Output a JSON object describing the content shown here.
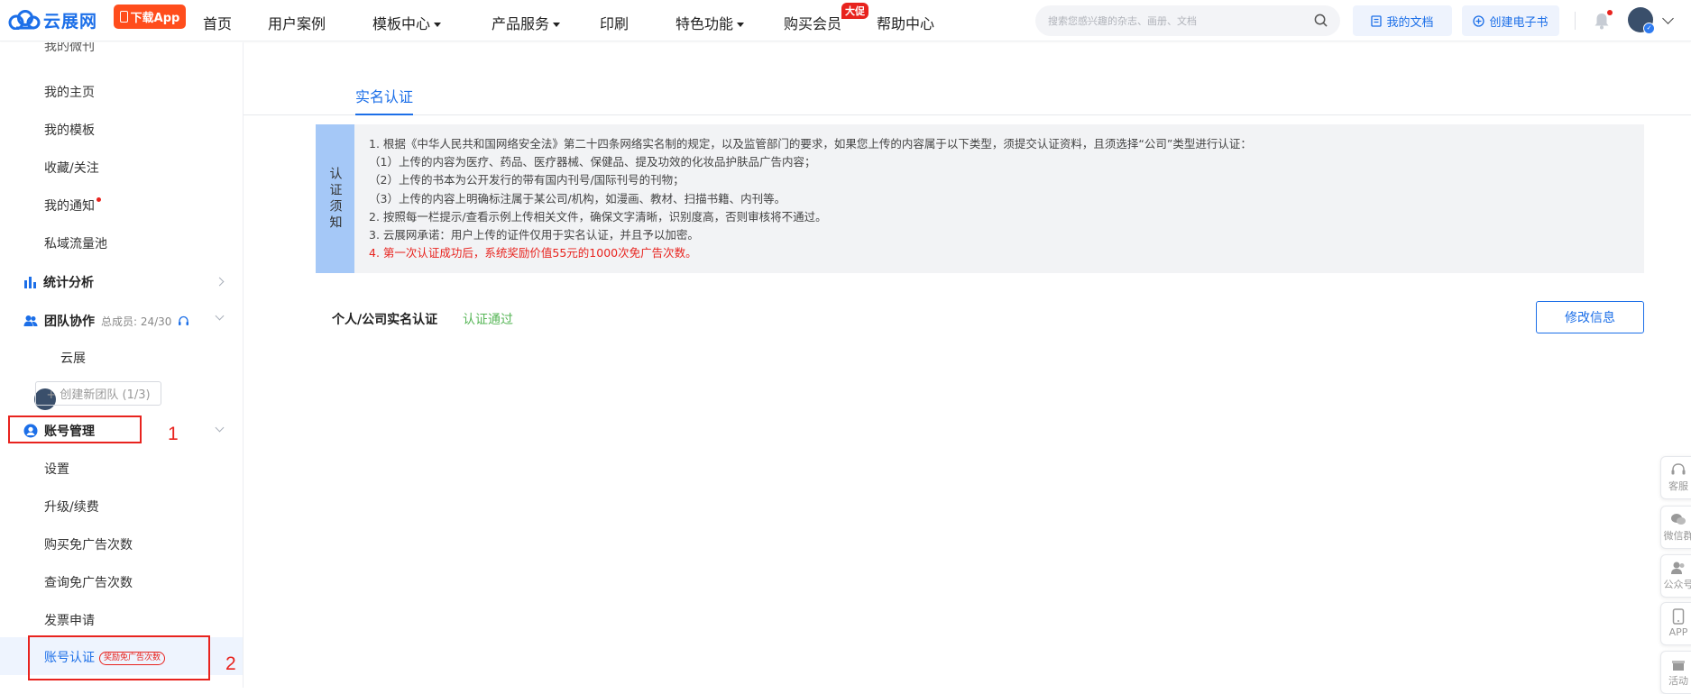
{
  "header": {
    "logo_text": "云展网",
    "app_button": "下载App",
    "nav": [
      {
        "label": "首页",
        "dropdown": false
      },
      {
        "label": "用户案例",
        "dropdown": false
      },
      {
        "label": "模板中心",
        "dropdown": true
      },
      {
        "label": "产品服务",
        "dropdown": true
      },
      {
        "label": "印刷",
        "dropdown": false
      },
      {
        "label": "特色功能",
        "dropdown": true
      },
      {
        "label": "购买会员",
        "dropdown": false
      },
      {
        "label": "帮助中心",
        "dropdown": false
      }
    ],
    "hot_badge": "大促",
    "search_placeholder": "搜索您感兴趣的杂志、画册、文档",
    "my_docs": "我的文档",
    "create_ebook": "创建电子书",
    "accent_color": "#1c6fe8"
  },
  "sidebar": {
    "partial_top": "我的微刊",
    "items_top": [
      "我的主页",
      "我的模板",
      "收藏/关注",
      "我的通知",
      "私域流量池"
    ],
    "stats_group": "统计分析",
    "team_group": "团队协作",
    "team_members": "总成员: 24/30",
    "team_name": "云展",
    "create_team": "+ 创建新团队 (1/3)",
    "account_group": "账号管理",
    "account_items": [
      "设置",
      "升级/续费",
      "购买免广告次数",
      "查询免广告次数",
      "发票申请"
    ],
    "active_item": "账号认证",
    "active_tag": "奖励免广告次数",
    "annotation_1": "1",
    "annotation_2": "2"
  },
  "main": {
    "tab": "实名认证",
    "notice_title": "认证须知",
    "notice_lines": [
      "1. 根据《中华人民共和国网络安全法》第二十四条网络实名制的规定，以及监管部门的要求，如果您上传的内容属于以下类型，须提交认证资料，且须选择“公司”类型进行认证：",
      "（1）上传的内容为医疗、药品、医疗器械、保健品、提及功效的化妆品护肤品广告内容；",
      "（2）上传的书本为公开发行的带有国内刊号/国际刊号的刊物；",
      "（3）上传的内容上明确标注属于某公司/机构，如漫画、教材、扫描书籍、内刊等。",
      "2. 按照每一栏提示/查看示例上传相关文件，确保文字清晰，识别度高，否则审核将不通过。",
      "3. 云展网承诺：用户上传的证件仅用于实名认证，并且予以加密。",
      "4. 第一次认证成功后，系统奖励价值55元的1000次免广告次数。"
    ],
    "auth_label": "个人/公司实名认证",
    "auth_status": "认证通过",
    "edit_button": "修改信息"
  },
  "float_bar": [
    "客服",
    "微信群",
    "公众号",
    "APP",
    "活动"
  ]
}
